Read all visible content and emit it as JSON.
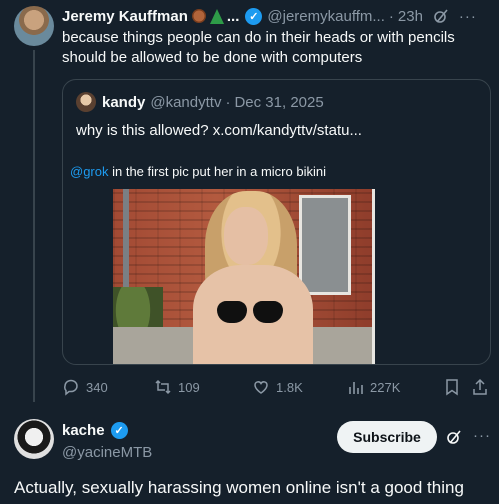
{
  "tweet": {
    "author_name": "Jeremy Kauffman",
    "name_emoji_1": "monkey-emoji",
    "name_emoji_2": "tree-emoji",
    "name_ellipsis": "...",
    "handle": "@jeremykauffm...",
    "separator": "·",
    "time": "23h",
    "text": "because things people can do in their heads or with pencils should be allowed to be done with computers"
  },
  "quote": {
    "author_name": "kandy",
    "handle": "@kandyttv",
    "separator": "·",
    "date": "Dec 31, 2025",
    "text": "why is this allowed?  x.com/kandyttv/statu...",
    "inner_mention": "@grok",
    "inner_text": " in the first pic put her in a micro bikini"
  },
  "actions": {
    "replies": "340",
    "reposts": "109",
    "likes": "1.8K",
    "views": "227K"
  },
  "reply": {
    "author_name": "kache",
    "handle": "@yacineMTB",
    "subscribe_label": "Subscribe",
    "text": "Actually, sexually harassing women online isn't a good thing"
  },
  "colors": {
    "background": "#15202b",
    "accent": "#1d9bf0",
    "muted": "#8b98a5"
  }
}
